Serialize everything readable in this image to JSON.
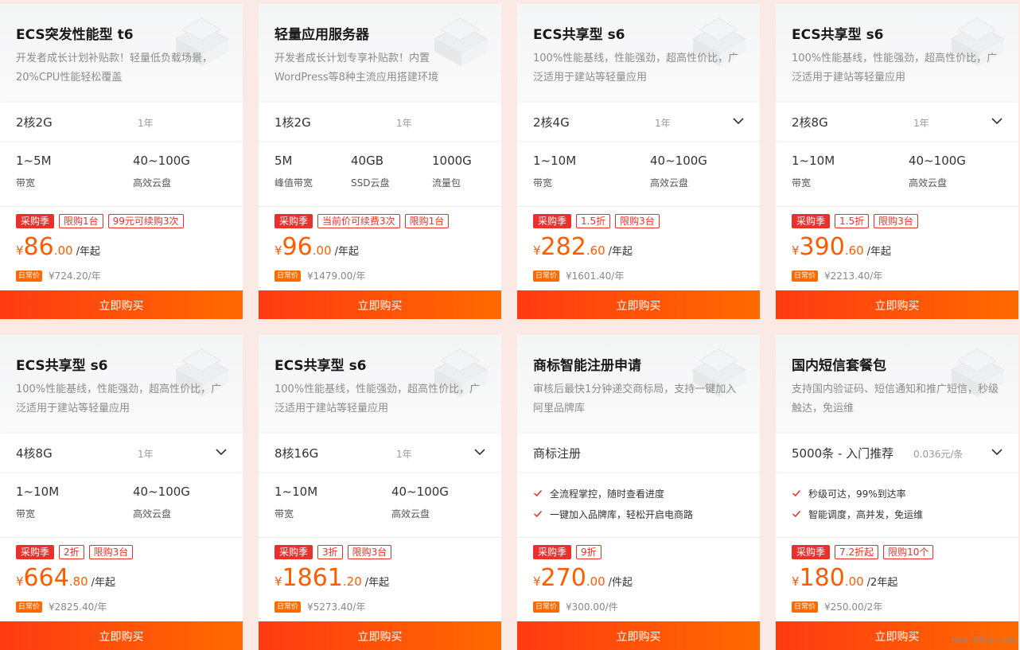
{
  "cards": [
    {
      "title": "ECS突发性能型 t6",
      "desc": "开发者成长计划补贴款！轻量低负载场景，20%CPU性能轻松覆盖",
      "spec": "2核2G",
      "period": "1年",
      "has_dropdown": false,
      "features": [
        {
          "value": "1~5M",
          "label": "带宽"
        },
        {
          "value": "40~100G",
          "label": "高效云盘"
        }
      ],
      "tags": [
        "采购季",
        "限购1台",
        "99元可续购3次"
      ],
      "price": {
        "yen": "¥",
        "int": "86",
        "dec": ".00",
        "unit": "/年起"
      },
      "orig_badge": "日常价",
      "orig": "¥724.20/年",
      "button": "立即购买"
    },
    {
      "title": "轻量应用服务器",
      "desc": "开发者成长计划专享补贴款！内置WordPress等8种主流应用搭建环境",
      "spec": "1核2G",
      "period": "1年",
      "has_dropdown": false,
      "features": [
        {
          "value": "5M",
          "label": "峰值带宽"
        },
        {
          "value": "40GB",
          "label": "SSD云盘"
        },
        {
          "value": "1000G",
          "label": "流量包"
        }
      ],
      "tags": [
        "采购季",
        "当前价可续费3次",
        "限购1台"
      ],
      "price": {
        "yen": "¥",
        "int": "96",
        "dec": ".00",
        "unit": "/年起"
      },
      "orig_badge": "日常价",
      "orig": "¥1479.00/年",
      "button": "立即购买"
    },
    {
      "title": "ECS共享型 s6",
      "desc": "100%性能基线，性能强劲，超高性价比，广泛适用于建站等轻量应用",
      "spec": "2核4G",
      "period": "1年",
      "has_dropdown": true,
      "features": [
        {
          "value": "1~10M",
          "label": "带宽"
        },
        {
          "value": "40~100G",
          "label": "高效云盘"
        }
      ],
      "tags": [
        "采购季",
        "1.5折",
        "限购3台"
      ],
      "price": {
        "yen": "¥",
        "int": "282",
        "dec": ".60",
        "unit": "/年起"
      },
      "orig_badge": "日常价",
      "orig": "¥1601.40/年",
      "button": "立即购买"
    },
    {
      "title": "ECS共享型 s6",
      "desc": "100%性能基线，性能强劲，超高性价比，广泛适用于建站等轻量应用",
      "spec": "2核8G",
      "period": "1年",
      "has_dropdown": true,
      "features": [
        {
          "value": "1~10M",
          "label": "带宽"
        },
        {
          "value": "40~100G",
          "label": "高效云盘"
        }
      ],
      "tags": [
        "采购季",
        "1.5折",
        "限购3台"
      ],
      "price": {
        "yen": "¥",
        "int": "390",
        "dec": ".60",
        "unit": "/年起"
      },
      "orig_badge": "日常价",
      "orig": "¥2213.40/年",
      "button": "立即购买"
    },
    {
      "title": "ECS共享型 s6",
      "desc": "100%性能基线，性能强劲，超高性价比，广泛适用于建站等轻量应用",
      "spec": "4核8G",
      "period": "1年",
      "has_dropdown": true,
      "features": [
        {
          "value": "1~10M",
          "label": "带宽"
        },
        {
          "value": "40~100G",
          "label": "高效云盘"
        }
      ],
      "tags": [
        "采购季",
        "2折",
        "限购3台"
      ],
      "price": {
        "yen": "¥",
        "int": "664",
        "dec": ".80",
        "unit": "/年起"
      },
      "orig_badge": "日常价",
      "orig": "¥2825.40/年",
      "button": "立即购买"
    },
    {
      "title": "ECS共享型 s6",
      "desc": "100%性能基线，性能强劲，超高性价比，广泛适用于建站等轻量应用",
      "spec": "8核16G",
      "period": "1年",
      "has_dropdown": true,
      "features": [
        {
          "value": "1~10M",
          "label": "带宽"
        },
        {
          "value": "40~100G",
          "label": "高效云盘"
        }
      ],
      "tags": [
        "采购季",
        "3折",
        "限购3台"
      ],
      "price": {
        "yen": "¥",
        "int": "1861",
        "dec": ".20",
        "unit": "/年起"
      },
      "orig_badge": "日常价",
      "orig": "¥5273.40/年",
      "button": "立即购买"
    },
    {
      "title": "商标智能注册申请",
      "desc": "审核后最快1分钟递交商标局，支持一键加入阿里品牌库",
      "spec": "商标注册",
      "has_dropdown": false,
      "checks": [
        "全流程掌控，随时查看进度",
        "一键加入品牌库，轻松开启电商路"
      ],
      "tags": [
        "采购季",
        "9折"
      ],
      "price": {
        "yen": "¥",
        "int": "270",
        "dec": ".00",
        "unit": "/件起"
      },
      "orig_badge": "日常价",
      "orig": "¥300.00/件",
      "button": "立即购买"
    },
    {
      "title": "国内短信套餐包",
      "desc": "支持国内验证码、短信通知和推广短信，秒级触达，免运维",
      "spec": "5000条 - 入门推荐",
      "unit_price": "0.036元/条",
      "has_dropdown": true,
      "checks": [
        "秒级可达，99%到达率",
        "智能调度，高并发，免运维"
      ],
      "tags": [
        "采购季",
        "7.2折起",
        "限购10个"
      ],
      "price": {
        "yen": "¥",
        "int": "180",
        "dec": ".00",
        "unit": "/2年起"
      },
      "orig_badge": "日常价",
      "orig": "¥250.00/2年",
      "button": "立即购买"
    }
  ],
  "watermark": "www.94ip.com",
  "colors": {
    "accent": "#ff5c00",
    "tag_red": "#e8312b",
    "button_start": "#ff3a12",
    "button_end": "#ff6a00"
  }
}
